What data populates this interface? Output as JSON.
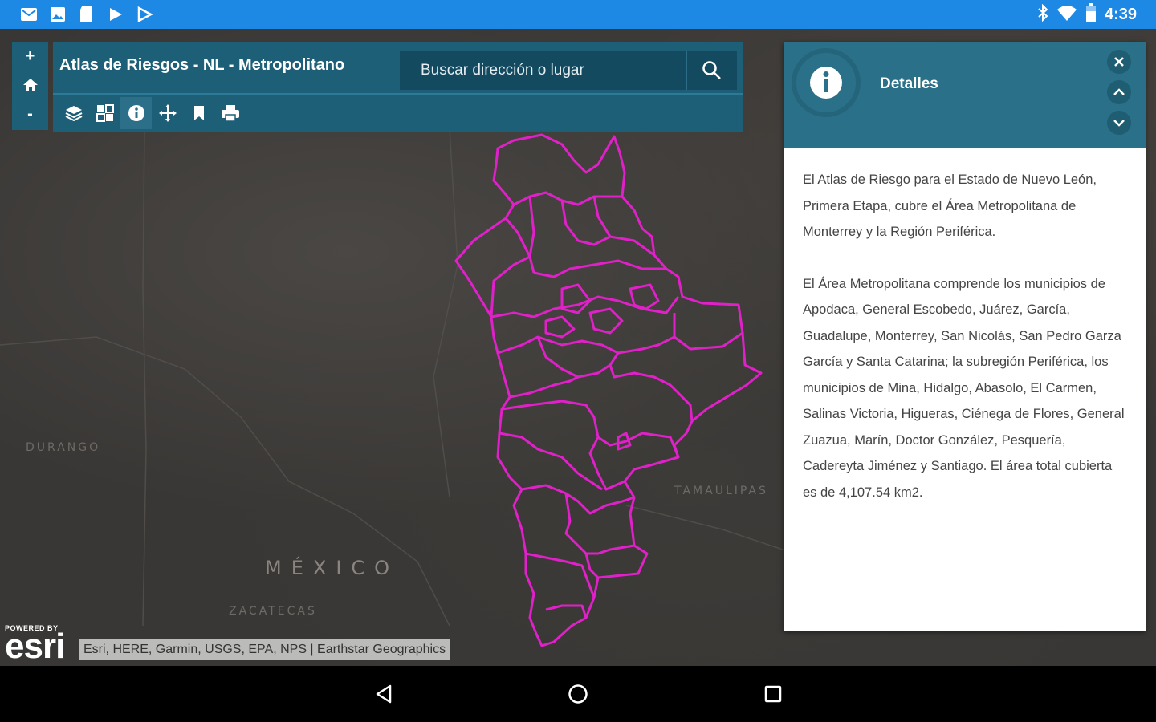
{
  "status_bar": {
    "time": "4:39",
    "left_icons": [
      "gmail-icon",
      "photos-icon",
      "clipboard-icon",
      "play-store-icon",
      "play-movies-icon"
    ],
    "right_icons": [
      "bluetooth-icon",
      "wifi-icon",
      "battery-icon"
    ],
    "color": "#1e88e5"
  },
  "header": {
    "title": "Atlas de Riesgos - NL - Metropolitano",
    "search_placeholder": "Buscar dirección o lugar",
    "color": "#1e5f78"
  },
  "zoom": {
    "in": "+",
    "home": "home-icon",
    "out": "-"
  },
  "toolbar": {
    "tools": [
      "layers-icon",
      "basemap-icon",
      "info-icon",
      "pan-icon",
      "bookmark-icon",
      "print-icon"
    ],
    "active": "info-icon"
  },
  "details": {
    "title": "Detalles",
    "paragraphs": [
      "El Atlas de Riesgo para el Estado de Nuevo León, Primera Etapa, cubre el Área Metropolitana de Monterrey y la Región Periférica.",
      "El Área Metropolitana comprende los municipios de Apodaca, General Escobedo, Juárez, García, Guadalupe, Monterrey, San Nicolás, San Pedro Garza García y Santa Catarina; la subregión Periférica, los municipios de Mina, Hidalgo, Abasolo, El Carmen, Salinas Victoria, Higueras, Ciénega de Flores, General Zuazua, Marín, Doctor González, Pesquería, Cadereyta Jiménez y Santiago. El área total cubierta es de 4,107.54 km2."
    ]
  },
  "map": {
    "labels": {
      "durango": "DURANGO",
      "tamaulipas": "TAMAULIPAS",
      "mexico": "MÉXICO",
      "zacatecas": "ZACATECAS"
    },
    "boundary_color": "#e020c8",
    "attribution": "Esri, HERE, Garmin, USGS, EPA, NPS | Earthstar Geographics",
    "logo_powered": "POWERED BY",
    "logo_word": "esri"
  }
}
